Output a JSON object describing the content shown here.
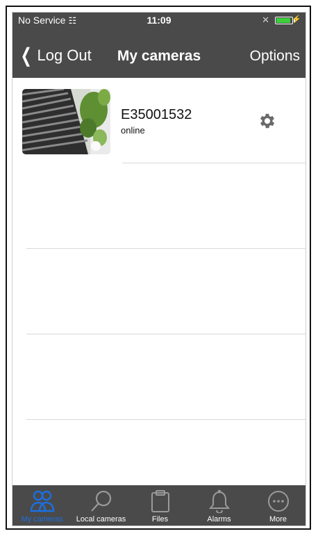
{
  "status_bar": {
    "carrier": "No Service",
    "time": "11:09"
  },
  "nav": {
    "back_label": "Log Out",
    "title": "My cameras",
    "options_label": "Options"
  },
  "cameras": [
    {
      "name": "E35001532",
      "status": "online"
    }
  ],
  "tabs": [
    {
      "label": "My cameras",
      "icon": "people-icon",
      "active": true
    },
    {
      "label": "Local cameras",
      "icon": "search-icon",
      "active": false
    },
    {
      "label": "Files",
      "icon": "clipboard-icon",
      "active": false
    },
    {
      "label": "Alarms",
      "icon": "bell-icon",
      "active": false
    },
    {
      "label": "More",
      "icon": "more-icon",
      "active": false
    }
  ],
  "colors": {
    "bar": "#4a4a4a",
    "accent": "#1c6fe0",
    "battery": "#3bd13b"
  }
}
